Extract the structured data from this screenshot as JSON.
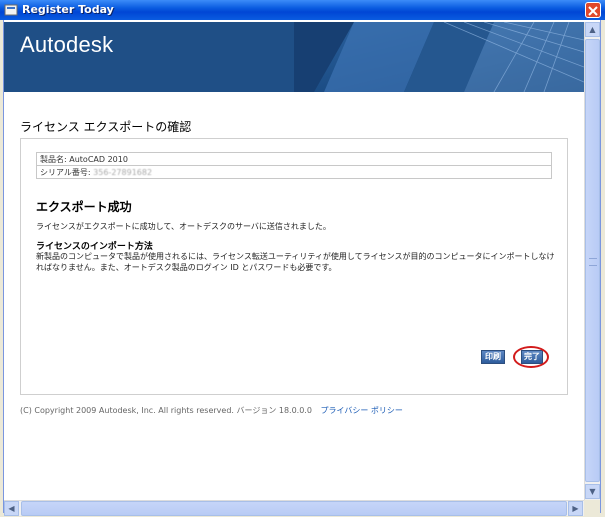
{
  "window": {
    "title": "Register Today"
  },
  "banner": {
    "logo_text": "Autodesk",
    "bg_color": "#1f4f86"
  },
  "content": {
    "page_title": "ライセンス エクスポートの確認",
    "product_label": "製品名:",
    "product_value": "AutoCAD 2010",
    "serial_label": "シリアル番号:",
    "serial_value": "356-27891682",
    "success_title": "エクスポート成功",
    "success_message": "ライセンスがエクスポートに成功して、オートデスクのサーバに送信されました。",
    "import_title": "ライセンスのインポート方法",
    "import_body": "新製品のコンピュータで製品が使用されるには、ライセンス転送ユーティリティが使用してライセンスが目的のコンピュータにインポートしなければなりません。また、オートデスク製品のログイン ID とパスワードも必要です。",
    "print_label": "印刷",
    "done_label": "完了",
    "highlight_color": "#d21b1b"
  },
  "footer": {
    "copyright": "(C) Copyright 2009 Autodesk, Inc. All rights reserved. バージョン 18.0.0.0",
    "privacy_link": "プライバシー ポリシー"
  }
}
